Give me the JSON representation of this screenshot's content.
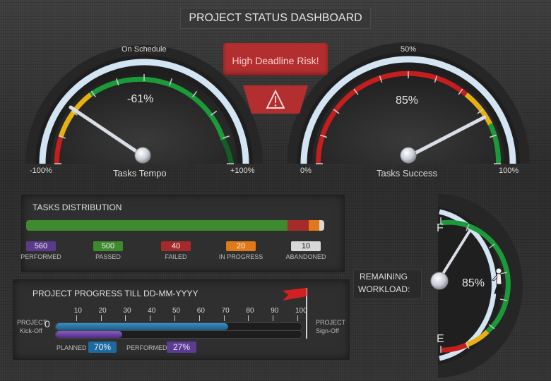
{
  "header": {
    "title": "PROJECT STATUS DASHBOARD"
  },
  "alerts": {
    "risk": "High Deadline Risk!",
    "warning_icon": "warning-icon"
  },
  "tempo_gauge": {
    "top_label": "On Schedule",
    "value_text": "-61%",
    "name": "Tasks Tempo",
    "min_label": "-100%",
    "max_label": "+100%",
    "value": -61
  },
  "success_gauge": {
    "top_label": "50%",
    "value_text": "85%",
    "name": "Tasks Success",
    "min_label": "0%",
    "max_label": "100%",
    "value": 85
  },
  "distribution": {
    "title": "TASKS DISTRIBUTION",
    "items": [
      {
        "count": "560",
        "label": "PERFORMED",
        "color": "#5b3a8c"
      },
      {
        "count": "500",
        "label": "PASSED",
        "color": "#3e8a2e"
      },
      {
        "count": "40",
        "label": "FAILED",
        "color": "#a52a2a"
      },
      {
        "count": "20",
        "label": "IN PROGRESS",
        "color": "#e07a18"
      },
      {
        "count": "10",
        "label": "ABANDONED",
        "color": "#d8d8d8"
      }
    ]
  },
  "progress": {
    "title": "PROJECT PROGRESS TILL DD-MM-YYYY",
    "start_label_1": "PROJECT",
    "start_label_2": "Kick-Off",
    "zero": "0",
    "end_label_1": "PROJECT",
    "end_label_2": "Sign-Off",
    "ticks": [
      "10",
      "20",
      "30",
      "40",
      "50",
      "60",
      "70",
      "80",
      "90",
      "100"
    ],
    "planned_label": "PLANNED",
    "planned_value": "70%",
    "planned": 70,
    "performed_label": "PERFORMED",
    "performed_value": "27%",
    "performed": 27
  },
  "workload": {
    "label_1": "REMAINING",
    "label_2": "WORKLOAD:",
    "value_text": "85%",
    "full_mark": "F",
    "empty_mark": "E",
    "value": 85
  }
}
